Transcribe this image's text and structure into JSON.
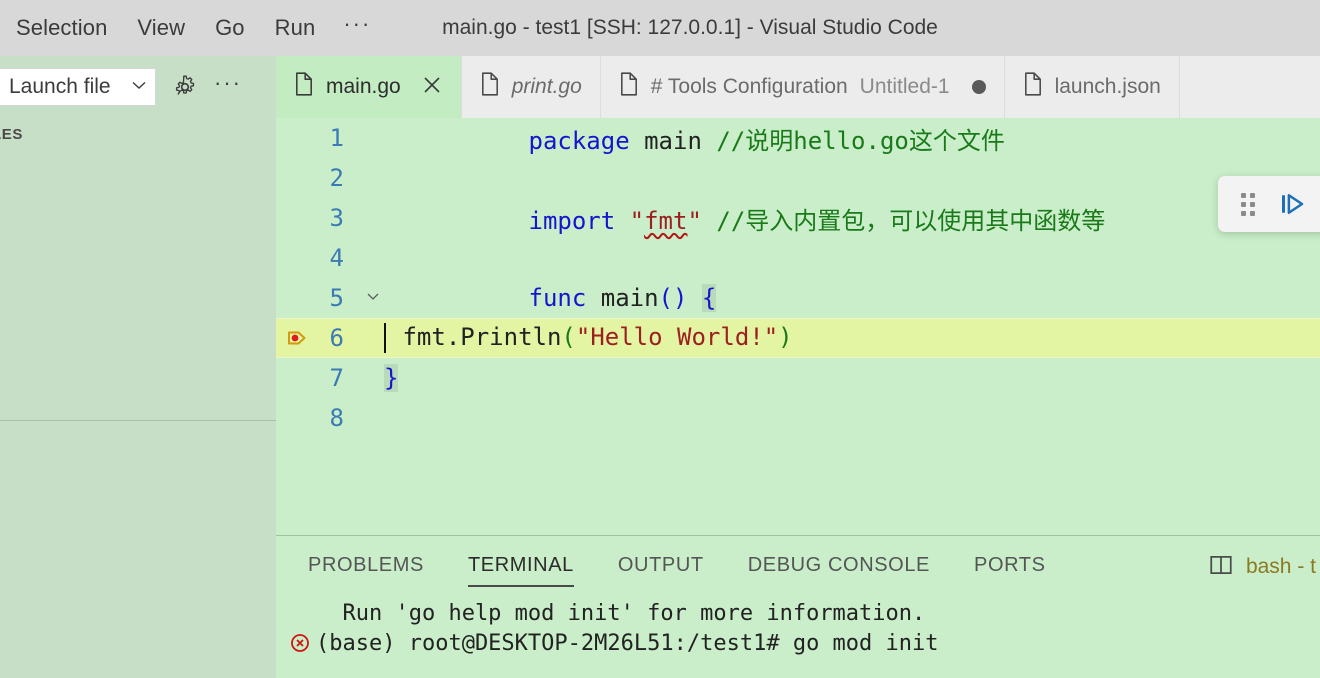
{
  "window": {
    "title": "main.go - test1 [SSH: 127.0.0.1] - Visual Studio Code"
  },
  "menubar": {
    "items": [
      {
        "label": "Selection",
        "name": "menu-selection"
      },
      {
        "label": "View",
        "name": "menu-view"
      },
      {
        "label": "Go",
        "name": "menu-go"
      },
      {
        "label": "Run",
        "name": "menu-run"
      }
    ],
    "more": "···"
  },
  "sidebar": {
    "launch_config": "Launch file",
    "chevron": "⌄",
    "gear_icon": "gear-icon",
    "more": "···",
    "section_title": "LES"
  },
  "tabs": [
    {
      "label": "main.go",
      "active": true,
      "dirty": false,
      "closeable": true,
      "italic": false,
      "sub": ""
    },
    {
      "label": "print.go",
      "active": false,
      "dirty": false,
      "closeable": false,
      "italic": true,
      "sub": ""
    },
    {
      "label": "# Tools Configuration",
      "active": false,
      "dirty": true,
      "closeable": false,
      "italic": false,
      "sub": "Untitled-1"
    },
    {
      "label": "launch.json",
      "active": false,
      "dirty": false,
      "closeable": false,
      "italic": false,
      "sub": ""
    }
  ],
  "editor": {
    "lines": [
      {
        "n": "1",
        "has_breakpoint": false,
        "fold": "",
        "highlight": false
      },
      {
        "n": "2",
        "has_breakpoint": false,
        "fold": "",
        "highlight": false
      },
      {
        "n": "3",
        "has_breakpoint": false,
        "fold": "",
        "highlight": false
      },
      {
        "n": "4",
        "has_breakpoint": false,
        "fold": "",
        "highlight": false
      },
      {
        "n": "5",
        "has_breakpoint": false,
        "fold": "⌄",
        "highlight": false
      },
      {
        "n": "6",
        "has_breakpoint": true,
        "fold": "",
        "highlight": true
      },
      {
        "n": "7",
        "has_breakpoint": false,
        "fold": "",
        "highlight": false
      },
      {
        "n": "8",
        "has_breakpoint": false,
        "fold": "",
        "highlight": false
      }
    ],
    "code": {
      "l1_kw": "package",
      "l1_name": "main",
      "l1_comment": "//说明hello.go这个文件",
      "l3_kw": "import",
      "l3_quote_open": "\"",
      "l3_pkg": "fmt",
      "l3_quote_close": "\"",
      "l3_comment": "//导入内置包，可以使用其中函数等",
      "l5_kw": "func",
      "l5_name": "main",
      "l5_parens": "()",
      "l5_brace": "{",
      "l6_pkg": "fmt",
      "l6_dot": ".",
      "l6_fn": "Println",
      "l6_lparen": "(",
      "l6_string": "\"Hello World!\"",
      "l6_rparen": ")",
      "l7_brace": "}"
    }
  },
  "debug_toolbar": {
    "buttons": [
      {
        "name": "debug-drag-handle",
        "title": "drag-handle-icon"
      },
      {
        "name": "debug-continue-button",
        "title": "continue-icon"
      },
      {
        "name": "debug-step-over-button",
        "title": "step-over-icon"
      },
      {
        "name": "debug-step-into-button",
        "title": "step-into-icon"
      },
      {
        "name": "debug-step-out-button",
        "title": "step-out-icon"
      },
      {
        "name": "debug-restart-button",
        "title": "restart-icon"
      },
      {
        "name": "debug-stop-button",
        "title": "stop-icon"
      }
    ]
  },
  "panel": {
    "tabs": [
      {
        "label": "PROBLEMS",
        "active": false
      },
      {
        "label": "TERMINAL",
        "active": true
      },
      {
        "label": "OUTPUT",
        "active": false
      },
      {
        "label": "DEBUG CONSOLE",
        "active": false
      },
      {
        "label": "PORTS",
        "active": false
      }
    ],
    "terminal_name": "bash - t",
    "split_icon": "split-terminal-icon"
  },
  "terminal": {
    "lines": [
      {
        "error": false,
        "text": "  Run 'go help mod init' for more information."
      },
      {
        "error": true,
        "text": "(base) root@DESKTOP-2M26L51:/test1# go mod init"
      }
    ]
  },
  "colors": {
    "editor_bg": "#c9eec9",
    "sidebar_bg": "#c7dfc7",
    "titlebar_bg": "#d8d8d8",
    "tab_inactive_bg": "#ececec",
    "tab_active_bg": "#c3ecc3",
    "line_highlight": "#e3f4a3",
    "keyword": "#1515cf",
    "comment": "#1a7a1a",
    "string": "#9c2020",
    "breakpoint": "#d19a10",
    "error": "#d11414",
    "debug_blue": "#1d6fb8",
    "debug_green": "#2e8b30",
    "debug_red": "#b33a20"
  }
}
